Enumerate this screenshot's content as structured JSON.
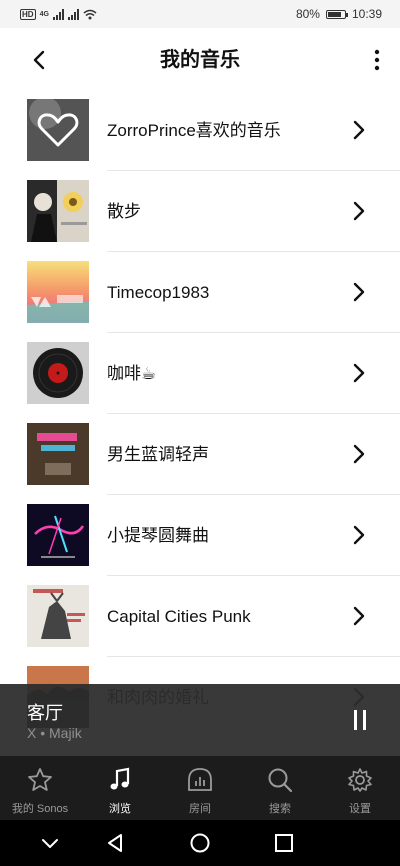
{
  "status_bar": {
    "network_label": "4G",
    "battery_percent": "80%",
    "battery_level": 0.8,
    "time": "10:39"
  },
  "header": {
    "title": "我的音乐"
  },
  "playlists": [
    {
      "label": "ZorroPrince喜欢的音乐",
      "cover": "heart-cover"
    },
    {
      "label": "散步",
      "cover": "girl-sunflower-cover"
    },
    {
      "label": "Timecop1983",
      "cover": "synthwave-sunset-cover"
    },
    {
      "label": "咖啡☕",
      "cover": "vinyl-record-cover"
    },
    {
      "label": "男生蓝调轻声",
      "cover": "neon-wood-cover"
    },
    {
      "label": "小提琴圆舞曲",
      "cover": "neon-night-cover"
    },
    {
      "label": "Capital Cities Punk",
      "cover": "capital-cities-cover"
    },
    {
      "label": "和肉肉的婚礼",
      "cover": "sunset-trees-cover"
    }
  ],
  "now_playing": {
    "room": "客厅",
    "track": "X • Majik"
  },
  "tabs": [
    {
      "label": "我的 Sonos",
      "icon": "star-icon",
      "active": false
    },
    {
      "label": "浏览",
      "icon": "music-note-icon",
      "active": true
    },
    {
      "label": "房间",
      "icon": "room-equalizer-icon",
      "active": false
    },
    {
      "label": "搜索",
      "icon": "search-icon",
      "active": false
    },
    {
      "label": "设置",
      "icon": "gear-icon",
      "active": false
    }
  ],
  "colors": {
    "tab_bar": "#1c1c1c",
    "now_playing_bar": "#2d2d2d",
    "accent": "#ffffff"
  }
}
